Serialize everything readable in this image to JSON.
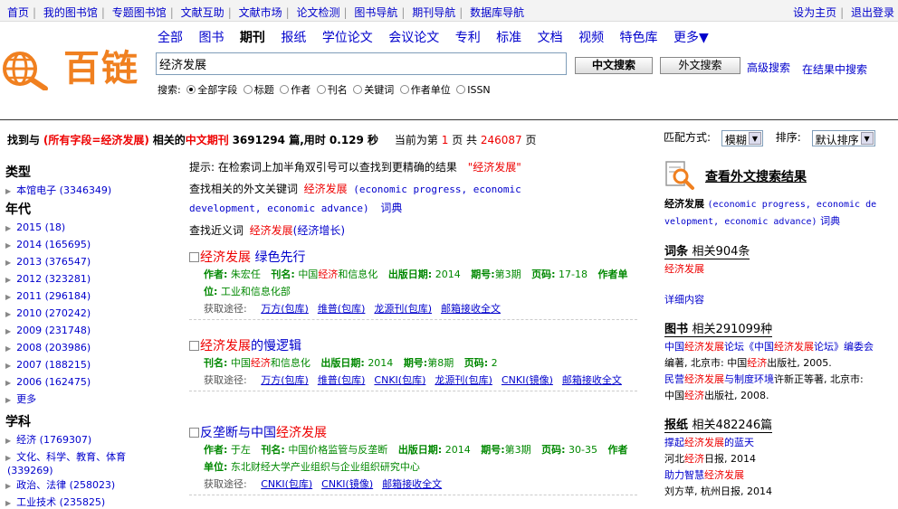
{
  "top_left_links": [
    "首页",
    "我的图书馆",
    "专题图书馆",
    "文献互助",
    "文献市场",
    "论文检测",
    "图书导航",
    "期刊导航",
    "数据库导航"
  ],
  "top_right_links": [
    "设为主页",
    "退出登录"
  ],
  "logo_text": "百链",
  "nav_tabs": [
    "全部",
    "图书",
    "期刊",
    "报纸",
    "学位论文",
    "会议论文",
    "专利",
    "标准",
    "文档",
    "视频",
    "特色库",
    "更多▼"
  ],
  "active_tab": "期刊",
  "search": {
    "value": "经济发展",
    "cn_button": "中文搜索",
    "en_button": "外文搜索",
    "advanced": "高级搜索",
    "within": "在结果中搜索"
  },
  "fields": {
    "label": "搜索:",
    "options": [
      "全部字段",
      "标题",
      "作者",
      "刊名",
      "关键词",
      "作者单位",
      "ISSN"
    ],
    "selected": "全部字段"
  },
  "summary": {
    "p1": "找到与",
    "p2": "(所有字段=经济发展)",
    "p3": "相关的",
    "p4": "中文期刊",
    "p5": "3691294 篇,用时 0.129 秒",
    "p6": "当前为第",
    "page": "1",
    "p7": "页 共",
    "total_pages": "246087",
    "p8": "页"
  },
  "match": {
    "label": "匹配方式:",
    "value": "模糊",
    "sort_label": "排序:",
    "sort_value": "默认排序"
  },
  "sidebar": {
    "type_heading": "类型",
    "type_items": [
      "本馆电子 (3346349)"
    ],
    "year_heading": "年代",
    "year_items": [
      "2015 (18)",
      "2014 (165695)",
      "2013 (376547)",
      "2012 (323281)",
      "2011 (296184)",
      "2010 (270242)",
      "2009 (231748)",
      "2008 (203986)",
      "2007 (188215)",
      "2006 (162475)",
      "更多"
    ],
    "subject_heading": "学科",
    "subject_items": [
      "经济 (1769307)",
      "文化、科学、教育、体育",
      "(339269)",
      "政治、法律 (258023)",
      "工业技术 (235825)"
    ]
  },
  "tip": {
    "text": "提示: 在检索词上加半角双引号可以查找到更精确的结果",
    "example": "\"经济发展\""
  },
  "related": {
    "label": "查找相关的外文关键词",
    "kw": "经济发展",
    "trans1": "(economic progress,  economic",
    "trans2": "development, economic advance)",
    "dict": "词典",
    "syn_label": "查找近义词",
    "syn_kw": "经济发展",
    "syn_rest": "(经济增长)"
  },
  "results": [
    {
      "title_red": "经济发展",
      "title_rest": " 绿色先行",
      "author_label": "作者:",
      "author": "朱宏任",
      "journal_label": "刊名:",
      "journal_pre": "中国",
      "journal_red": "经济",
      "journal_post": "和信息化",
      "date_label": "出版日期:",
      "date": "2014",
      "issue_label": "期号:",
      "issue": "第3期",
      "pages_label": "页码:",
      "pages": "17-18",
      "org_label": "作者单位:",
      "org": "工业和信息化部",
      "access_label": "获取途径:",
      "access": [
        "万方(包库)",
        "维普(包库)",
        "龙源刊(包库)",
        "邮箱接收全文"
      ]
    },
    {
      "title_red": "经济发展",
      "title_rest": "的慢逻辑",
      "journal_label": "刊名:",
      "journal_pre": "中国",
      "journal_red": "经济",
      "journal_post": "和信息化",
      "date_label": "出版日期:",
      "date": "2014",
      "issue_label": "期号:",
      "issue": "第8期",
      "pages_label": "页码:",
      "pages": "2",
      "access_label": "获取途径:",
      "access": [
        "万方(包库)",
        "维普(包库)",
        "CNKI(包库)",
        "龙源刊(包库)",
        "CNKI(镜像)",
        "邮箱接收全文"
      ]
    },
    {
      "title_pre": "反垄断与中国",
      "title_red": "经济发展",
      "author_label": "作者:",
      "author": "于左",
      "journal_label": "刊名:",
      "journal": "中国价格监管与反垄断",
      "date_label": "出版日期:",
      "date": "2014",
      "issue_label": "期号:",
      "issue": "第3期",
      "pages_label": "页码:",
      "pages": "30-35",
      "org_label": "作者单位:",
      "org": "东北财经大学产业组织与企业组织研究中心",
      "access_label": "获取途径:",
      "access": [
        "CNKI(包库)",
        "CNKI(镜像)",
        "邮箱接收全文"
      ]
    }
  ],
  "right": {
    "ext_title": "查看外文搜索结果",
    "ext_kw": "经济发展",
    "ext_trans1": "(economic progress,  economic de",
    "ext_trans2": "velopment, economic advance)",
    "ext_dict": "词典",
    "ci_head": "词条",
    "ci_count": "相关904条",
    "ci_item": "经济发展",
    "ci_detail": "详细内容",
    "book_head": "图书",
    "book_count": "相关291099种",
    "book1_a": "中国",
    "book1_b": "经济发展",
    "book1_c": "论坛《中国",
    "book1_d": "经济发展",
    "book1_e": "论坛》编委会",
    "book1_line2": "编著, 北京市: 中国",
    "book1_red2": "经济",
    "book1_rest2": "出版社, 2005.",
    "book2_a": "民营",
    "book2_b": "经济发展",
    "book2_c": "与制度环境",
    "book2_d": "许新正等著, 北京市:",
    "book2_line2": "中国",
    "book2_red2": "经济",
    "book2_rest2": "出版社, 2008.",
    "np_head": "报纸",
    "np_count": "相关482246篇",
    "np1_a": "撑起",
    "np1_b": "经济发展",
    "np1_c": "的蓝天",
    "np1_src_a": "河北",
    "np1_src_b": "经济",
    "np1_src_c": "日报, 2014",
    "np2_a": "助力智慧",
    "np2_b": "经济发展",
    "np2_src": "刘方苹, 杭州日报, 2014"
  }
}
